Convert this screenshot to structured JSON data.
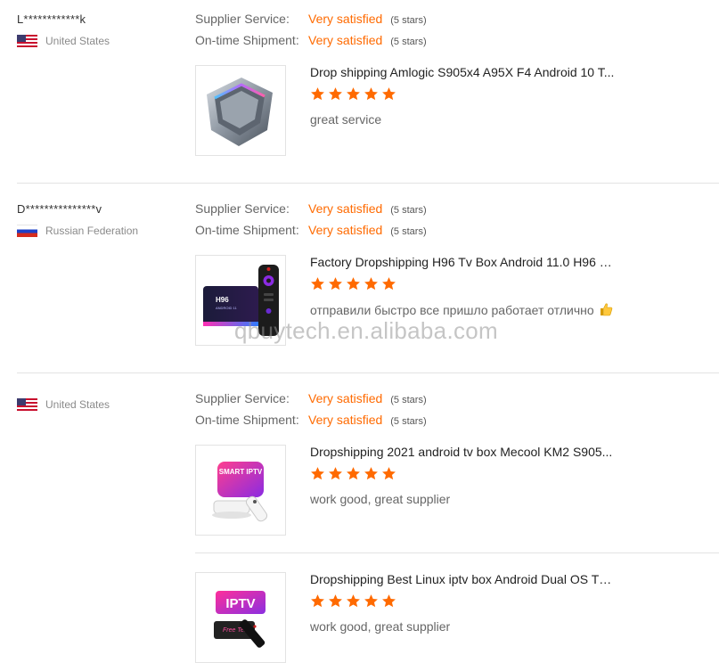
{
  "labels": {
    "supplier_service": "Supplier Service:",
    "on_time_shipment": "On-time Shipment:"
  },
  "reviews": [
    {
      "user": "L************k",
      "country": "United States",
      "flag": "us-flag",
      "supplier_service": {
        "value": "Very satisfied",
        "stars": "(5 stars)"
      },
      "on_time_shipment": {
        "value": "Very satisfied",
        "stars": "(5 stars)"
      },
      "products": [
        {
          "title": "Drop shipping Amlogic S905x4 A95X F4 Android 10 T...",
          "rating": 5,
          "comment": "great service",
          "image": "tv-box-hexagon-image"
        }
      ]
    },
    {
      "user": "D***************v",
      "country": "Russian Federation",
      "flag": "ru-flag",
      "supplier_service": {
        "value": "Very satisfied",
        "stars": "(5 stars)"
      },
      "on_time_shipment": {
        "value": "Very satisfied",
        "stars": "(5 stars)"
      },
      "products": [
        {
          "title": "Factory Dropshipping H96 Tv Box Android 11.0 H96 M...",
          "rating": 5,
          "comment": "отправили быстро все пришло работает отлично",
          "emoji": "thumbs-up-icon",
          "image": "h96-box-remote-image"
        }
      ]
    },
    {
      "user": "",
      "country": "United States",
      "flag": "us-flag",
      "supplier_service": {
        "value": "Very satisfied",
        "stars": "(5 stars)"
      },
      "on_time_shipment": {
        "value": "Very satisfied",
        "stars": "(5 stars)"
      },
      "products": [
        {
          "title": "Dropshipping 2021 android tv box Mecool KM2 S905...",
          "rating": 5,
          "comment": "work good, great supplier",
          "image": "smart-iptv-image",
          "image_text": "SMART IPTV"
        },
        {
          "title": "Dropshipping Best Linux iptv box Android Dual OS TV ...",
          "rating": 5,
          "comment": "work good, great supplier",
          "image": "iptv-free-test-image",
          "image_text": "IPTV",
          "image_subtext": "Free Test"
        }
      ]
    }
  ],
  "watermark": "qbuytech.en.alibaba.com",
  "colors": {
    "accent": "#ff6a00",
    "star": "#ff6a00",
    "divider": "#e3e3e3"
  }
}
